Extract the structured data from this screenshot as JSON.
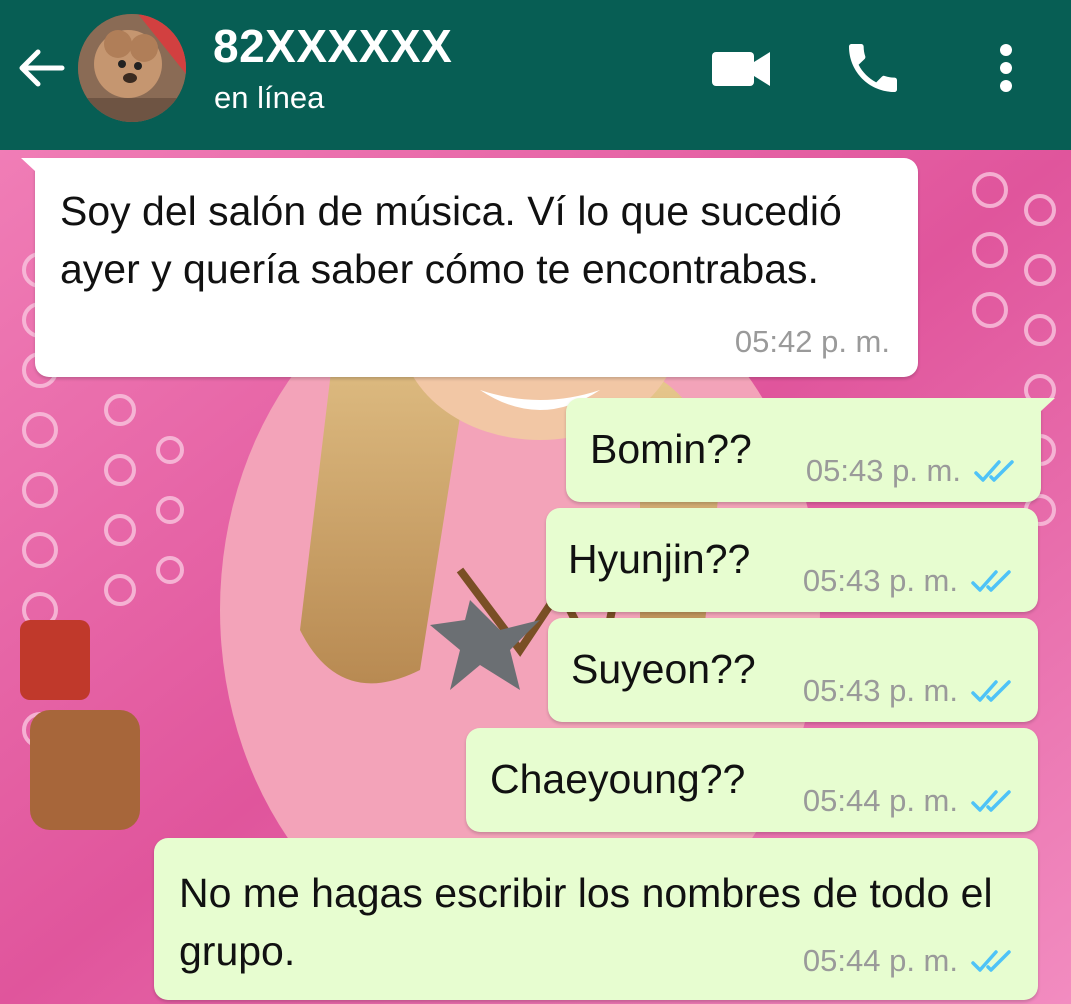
{
  "header": {
    "contact_name": "82XXXXXX",
    "status": "en línea",
    "icons": [
      "back-arrow-icon",
      "avatar",
      "video-call-icon",
      "voice-call-icon",
      "more-options-icon"
    ]
  },
  "colors": {
    "header_bg": "#075e54",
    "incoming_bubble": "#ffffff",
    "outgoing_bubble": "#e7fdd0",
    "read_check": "#4fc3f7",
    "timestamp": "#9a9a9a"
  },
  "messages": [
    {
      "direction": "incoming",
      "text": "Soy del salón de música. Ví lo que sucedió ayer y quería saber cómo te encontrabas.",
      "time": "05:42 p. m."
    },
    {
      "direction": "outgoing",
      "text": "Bomin??",
      "time": "05:43 p. m.",
      "status": "read"
    },
    {
      "direction": "outgoing",
      "text": "Hyunjin??",
      "time": "05:43 p. m.",
      "status": "read"
    },
    {
      "direction": "outgoing",
      "text": "Suyeon??",
      "time": "05:43 p. m.",
      "status": "read"
    },
    {
      "direction": "outgoing",
      "text": "Chaeyoung??",
      "time": "05:44 p. m.",
      "status": "read"
    },
    {
      "direction": "outgoing",
      "text": "No me hagas escribir los nombres de todo el grupo.",
      "time": "05:44 p. m.",
      "status": "read"
    }
  ]
}
